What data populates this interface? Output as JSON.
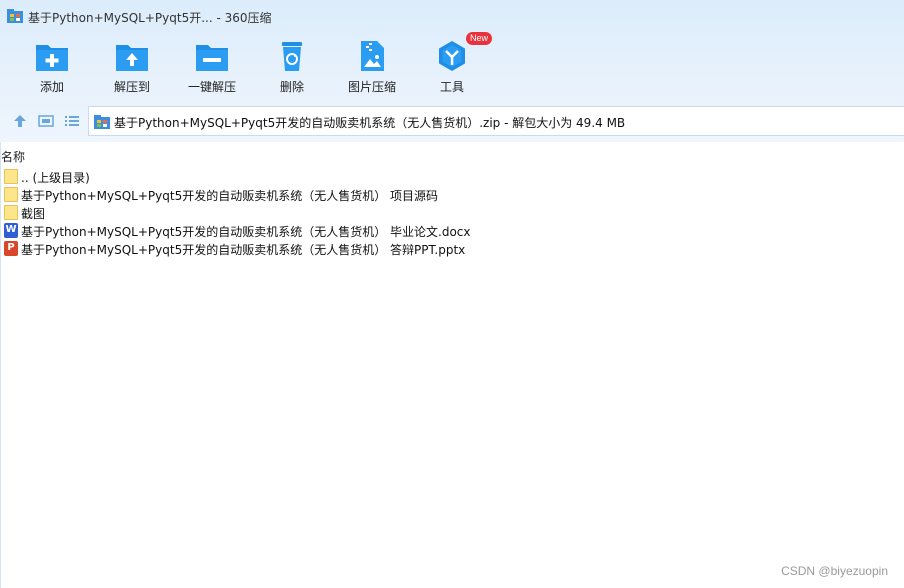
{
  "window": {
    "title": "基于Python+MySQL+Pyqt5开... - 360压缩"
  },
  "toolbar": {
    "items": [
      {
        "label": "添加",
        "icon": "add-file-icon"
      },
      {
        "label": "解压到",
        "icon": "extract-to-icon"
      },
      {
        "label": "一键解压",
        "icon": "one-click-extract-icon"
      },
      {
        "label": "删除",
        "icon": "recycle-bin-icon"
      },
      {
        "label": "图片压缩",
        "icon": "image-compress-icon"
      },
      {
        "label": "工具",
        "icon": "tools-icon",
        "badge": "New"
      }
    ]
  },
  "navbar": {
    "path": "基于Python+MySQL+Pyqt5开发的自动贩卖机系统（无人售货机）.zip - 解包大小为 49.4 MB"
  },
  "list": {
    "column_name": "名称",
    "rows": [
      {
        "type": "folder",
        "name": ".. (上级目录)"
      },
      {
        "type": "folder",
        "name": "基于Python+MySQL+Pyqt5开发的自动贩卖机系统（无人售货机） 项目源码"
      },
      {
        "type": "folder",
        "name": "截图"
      },
      {
        "type": "word",
        "icon_letter": "W",
        "name": "基于Python+MySQL+Pyqt5开发的自动贩卖机系统（无人售货机） 毕业论文.docx"
      },
      {
        "type": "ppt",
        "icon_letter": "P",
        "name": "基于Python+MySQL+Pyqt5开发的自动贩卖机系统（无人售货机） 答辩PPT.pptx"
      }
    ]
  },
  "watermark": "CSDN @biyezuopin",
  "colors": {
    "accent": "#1e8ee6",
    "folder": "#fde58c",
    "word": "#2f5fd3",
    "ppt": "#d9472b",
    "badge": "#e8323c"
  }
}
